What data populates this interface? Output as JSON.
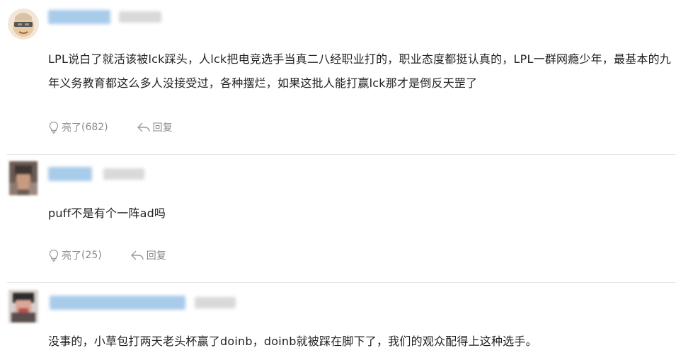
{
  "comments": [
    {
      "text": "LPL说白了就活该被lck踩头，人lck把电竞选手当真二八经职业打的，职业态度都挺认真的，LPL一群网瘾少年，最基本的九年义务教育都这么多人没接受过，各种摆烂，如果这批人能打赢lck那才是倒反天罡了",
      "like_label": "亮了",
      "like_count": "(682)",
      "reply_label": "回复"
    },
    {
      "text": "puff不是有个一阵ad吗",
      "like_label": "亮了",
      "like_count": "(25)",
      "reply_label": "回复"
    },
    {
      "text": "没事的，小草包打两天老头杯赢了doinb，doinb就被踩在脚下了，我们的观众配得上这种选手。"
    }
  ],
  "colors": {
    "name_blur": "#a9cbea",
    "time_blur": "#d9d9d9",
    "divider": "#e6e6e6",
    "action_text": "#8a8a8a"
  }
}
